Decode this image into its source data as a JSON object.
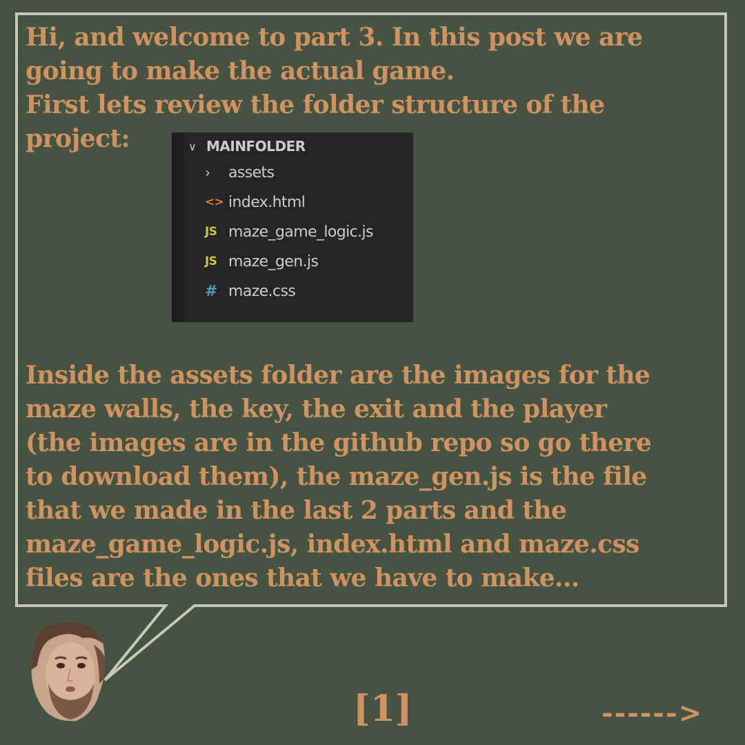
{
  "colors": {
    "background": "#455442",
    "text": "#d09260",
    "bubble_border": "#c8c8b4"
  },
  "intro_lines": [
    "Hi, and welcome to part 3. In this post we are",
    "going to make the actual game.",
    "First lets review the folder structure of the",
    "project:"
  ],
  "explorer": {
    "root": "MAINFOLDER",
    "items": [
      {
        "icon": "chevron-right-icon",
        "glyph": "›",
        "label": "assets"
      },
      {
        "icon": "html-file-icon",
        "glyph": "<>",
        "label": "index.html"
      },
      {
        "icon": "js-file-icon",
        "glyph": "JS",
        "label": "maze_game_logic.js"
      },
      {
        "icon": "js-file-icon",
        "glyph": "JS",
        "label": "maze_gen.js"
      },
      {
        "icon": "css-file-icon",
        "glyph": "#",
        "label": "maze.css"
      }
    ]
  },
  "body_lines": [
    "Inside the assets folder are the images for the",
    "maze walls, the key, the exit and the player",
    "(the images are in the github repo so go there",
    "to download them), the maze_gen.js is the file",
    "that we made in the last 2 parts and the",
    "maze_game_logic.js, index.html and maze.css",
    "files are the ones that we have to make..."
  ],
  "page_number": "[1]",
  "next_arrow": "------>"
}
